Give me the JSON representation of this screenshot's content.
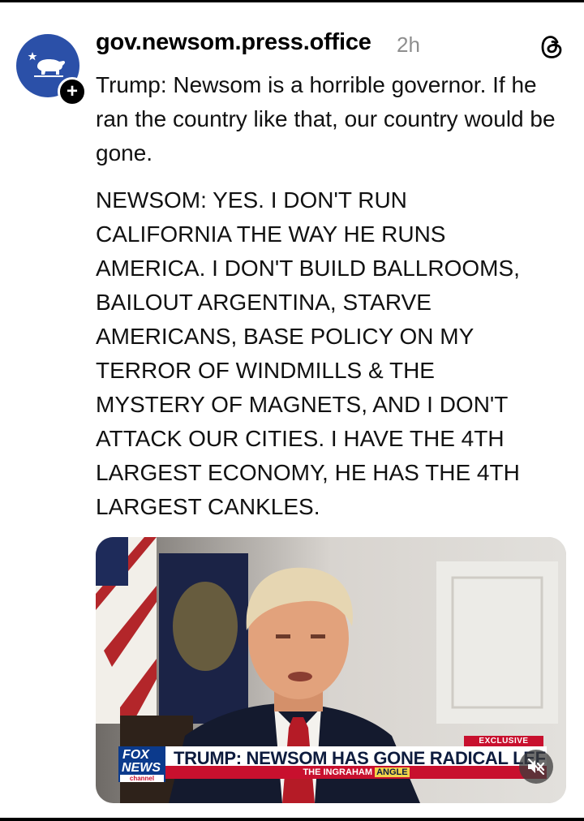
{
  "post": {
    "username": "gov.newsom.press.office",
    "timestamp": "2h",
    "follow_symbol": "+",
    "text_paragraph_1": "Trump: Newsom is a horrible governor. If he ran the country like that, our country would be gone.",
    "text_paragraph_2": "NEWSOM: YES. I DON'T RUN\nCALIFORNIA THE WAY HE RUNS\nAMERICA. I DON'T BUILD BALLROOMS,\nBAILOUT ARGENTINA, STARVE\nAMERICANS, BASE POLICY ON MY\nTERROR OF WINDMILLS & THE\nMYSTERY OF MAGNETS, AND I DON'T\nATTACK OUR CITIES. I HAVE THE 4TH\nLARGEST ECONOMY, HE HAS THE 4TH\nLARGEST CANKLES."
  },
  "video": {
    "exclusive_label": "EXCLUSIVE",
    "logo_line_1": "FOX",
    "logo_line_2": "NEWS",
    "logo_line_3": "channel",
    "headline": "TRUMP: NEWSOM HAS GONE RADICAL LEF",
    "show_name_prefix": "THE INGRAHAM",
    "show_name_suffix": "ANGLE"
  },
  "icons": {
    "avatar": "california-bear-icon",
    "app": "threads-icon",
    "mute": "muted-speaker-icon"
  },
  "colors": {
    "avatar_blue": "#2b50a8",
    "fox_blue": "#0b3a8c",
    "fox_red": "#c8102e",
    "timestamp_gray": "#8e8e8e"
  }
}
